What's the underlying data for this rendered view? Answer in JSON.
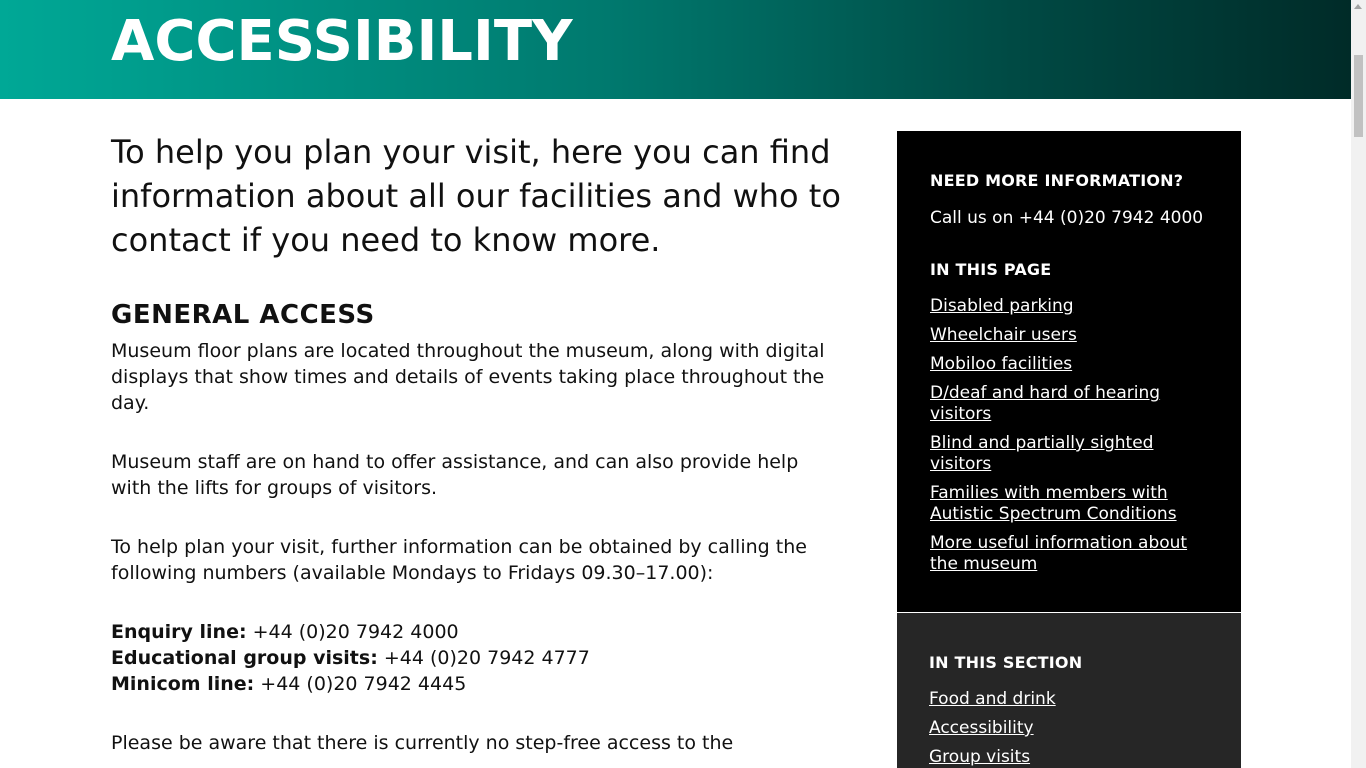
{
  "hero": {
    "title": "ACCESSIBILITY"
  },
  "main": {
    "intro": "To help you plan your visit, here you can find information about all our facilities and who to contact if you need to know more.",
    "section_heading": "GENERAL ACCESS",
    "paragraphs": [
      "Museum floor plans are located throughout the museum, along with digital displays that show times and details of events taking place throughout the day.",
      "Museum staff are on hand to offer assistance, and can also provide help with the lifts for groups of visitors.",
      "To help plan your visit, further information can be obtained by calling the following numbers (available Mondays to Fridays 09.30–17.00):"
    ],
    "contacts": [
      {
        "label": "Enquiry line:",
        "value": " +44 (0)20 7942 4000"
      },
      {
        "label": "Educational group visits:",
        "value": " +44 (0)20 7942 4777"
      },
      {
        "label": "Minicom line:",
        "value": " +44 (0)20 7942 4445"
      }
    ],
    "last_paragraph": "Please be aware that there is currently no step-free access to the"
  },
  "sidebar": {
    "info_title": "NEED MORE INFORMATION?",
    "info_text": "Call us on +44 (0)20 7942 4000",
    "page_title": "IN THIS PAGE",
    "page_links": [
      "Disabled parking",
      "Wheelchair users",
      "Mobiloo facilities",
      "D/deaf and hard of hearing visitors",
      "Blind and partially sighted visitors",
      "Families with members with Autistic Spectrum Conditions",
      "More useful information about the museum"
    ],
    "section_title": "IN THIS SECTION",
    "section_links": [
      "Food and drink",
      "Accessibility",
      "Group visits"
    ]
  },
  "colors": {
    "hero_start": "#00a896",
    "hero_end": "#002b28",
    "sidebar_black": "#000000",
    "sidebar_dark": "#262626"
  }
}
